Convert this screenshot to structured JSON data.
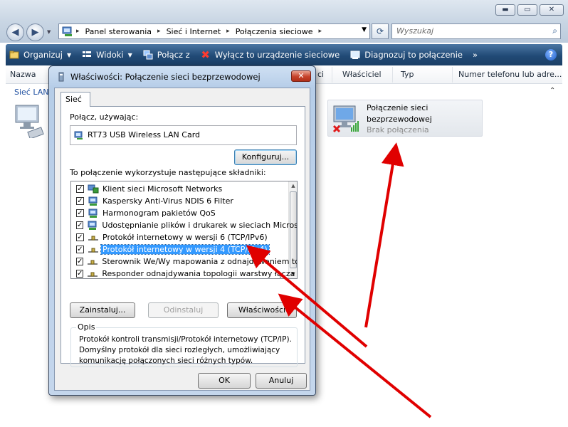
{
  "window": {
    "minimize": "▬",
    "maximize": "▭",
    "close": "✕"
  },
  "address": {
    "back_icon": "back-arrow-icon",
    "forward_icon": "forward-arrow-icon",
    "segments": [
      "Panel sterowania",
      "Sieć i Internet",
      "Połączenia sieciowe"
    ],
    "search_placeholder": "Wyszukaj"
  },
  "toolbar": {
    "organize": "Organizuj",
    "views": "Widoki",
    "connect": "Połącz z",
    "disable": "Wyłącz to urządzenie sieciowe",
    "diagnose": "Diagnozuj to połączenie",
    "more": "»",
    "help": "?"
  },
  "columns": {
    "name": "Nazwa",
    "partial": "ci",
    "owner": "Właściciel",
    "type": "Typ",
    "phone": "Numer telefonu lub adre..."
  },
  "content": {
    "group_label": "Sieć LAN",
    "connection": {
      "name_line1": "Połączenie sieci",
      "name_line2": "bezprzewodowej",
      "status": "Brak połączenia"
    }
  },
  "dialog": {
    "title": "Właściwości: Połączenie sieci bezprzewodowej",
    "close": "✕",
    "tab": "Sieć",
    "connect_using_label": "Połącz, używając:",
    "adapter": "RT73 USB Wireless LAN Card",
    "configure_button": "Konfiguruj...",
    "components_label": "To połączenie wykorzystuje następujące składniki:",
    "components": [
      {
        "label": "Klient sieci Microsoft Networks",
        "checked": true,
        "icon": "network-client-icon"
      },
      {
        "label": "Kaspersky Anti-Virus NDIS 6 Filter",
        "checked": true,
        "icon": "network-service-icon"
      },
      {
        "label": "Harmonogram pakietów QoS",
        "checked": true,
        "icon": "network-service-icon"
      },
      {
        "label": "Udostępnianie plików i drukarek w sieciach Microsoft N...",
        "checked": true,
        "icon": "network-service-icon"
      },
      {
        "label": "Protokół internetowy w wersji 6 (TCP/IPv6)",
        "checked": true,
        "icon": "protocol-icon"
      },
      {
        "label": "Protokół internetowy w wersji 4 (TCP/IPv4)",
        "checked": true,
        "icon": "protocol-icon",
        "selected": true
      },
      {
        "label": "Sterownik We/Wy mapowania z odnajdywaniem topolo...",
        "checked": true,
        "icon": "protocol-icon"
      },
      {
        "label": "Responder odnajdywania topologii warstwy łącza",
        "checked": true,
        "icon": "protocol-icon"
      }
    ],
    "install_button": "Zainstaluj...",
    "uninstall_button": "Odinstaluj",
    "properties_button": "Właściwości",
    "description_title": "Opis",
    "description_text": "Protokół kontroli transmisji/Protokół internetowy (TCP/IP). Domyślny protokół dla sieci rozległych, umożliwiający komunikację połączonych sieci różnych typów.",
    "ok_button": "OK",
    "cancel_button": "Anuluj"
  },
  "colors": {
    "toolbar": "#214a76",
    "selection": "#3399ff",
    "annotation_arrow": "#e00000",
    "link_blue": "#1e4fa0"
  }
}
